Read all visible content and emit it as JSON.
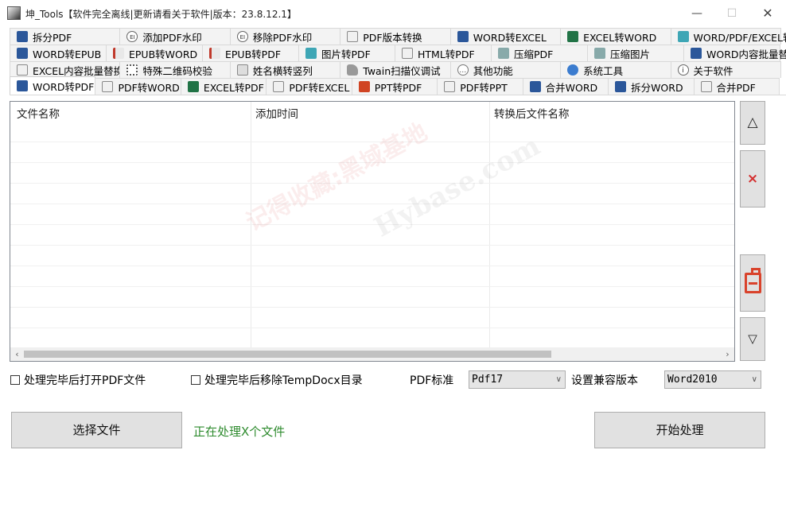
{
  "window": {
    "title": "坤_Tools【软件完全离线|更新请看关于软件|版本：23.8.12.1】",
    "min_icon": "minimize-icon",
    "max_icon": "maximize-icon",
    "close_icon": "close-icon"
  },
  "tab_rows": [
    [
      {
        "label": "拆分PDF",
        "icon": "word"
      },
      {
        "label": "添加PDF水印",
        "icon": "ring"
      },
      {
        "label": "移除PDF水印",
        "icon": "ring"
      },
      {
        "label": "PDF版本转换",
        "icon": "pdf"
      },
      {
        "label": "WORD转EXCEL",
        "icon": "word"
      },
      {
        "label": "EXCEL转WORD",
        "icon": "excel"
      },
      {
        "label": "WORD/PDF/EXCEL转图片",
        "icon": "img"
      }
    ],
    [
      {
        "label": "WORD转EPUB",
        "icon": "word"
      },
      {
        "label": "EPUB转WORD",
        "icon": "epub"
      },
      {
        "label": "EPUB转PDF",
        "icon": "epub"
      },
      {
        "label": "图片转PDF",
        "icon": "img"
      },
      {
        "label": "HTML转PDF",
        "icon": "pdf"
      },
      {
        "label": "压缩PDF",
        "icon": "zip"
      },
      {
        "label": "压缩图片",
        "icon": "zip"
      },
      {
        "label": "WORD内容批量替换",
        "icon": "word"
      }
    ],
    [
      {
        "label": "EXCEL内容批量替换",
        "icon": "pdf"
      },
      {
        "label": "特殊二维码校验",
        "icon": "qr"
      },
      {
        "label": "姓名横转竖列",
        "icon": "name"
      },
      {
        "label": "Twain扫描仪调试",
        "icon": "scan"
      },
      {
        "label": "其他功能",
        "icon": "more"
      },
      {
        "label": "系统工具",
        "icon": "gear"
      },
      {
        "label": "关于软件",
        "icon": "info"
      }
    ],
    [
      {
        "label": "WORD转PDF",
        "icon": "word",
        "active": true
      },
      {
        "label": "PDF转WORD",
        "icon": "pdf"
      },
      {
        "label": "EXCEL转PDF",
        "icon": "excel"
      },
      {
        "label": "PDF转EXCEL",
        "icon": "pdf"
      },
      {
        "label": "PPT转PDF",
        "icon": "ppt"
      },
      {
        "label": "PDF转PPT",
        "icon": "pdf"
      },
      {
        "label": "合并WORD",
        "icon": "word"
      },
      {
        "label": "拆分WORD",
        "icon": "word"
      },
      {
        "label": "合并PDF",
        "icon": "pdf"
      }
    ]
  ],
  "file_list": {
    "columns": [
      "文件名称",
      "添加时间",
      "转换后文件名称"
    ],
    "rows": []
  },
  "side_buttons": {
    "up": "△",
    "delete": "×",
    "clear_icon": "trash-clear-icon",
    "down": "▽"
  },
  "options": {
    "open_pdf_after": "处理完毕后打开PDF文件",
    "remove_temp_after": "处理完毕后移除TempDocx目录",
    "pdf_standard_label": "PDF标准",
    "pdf_standard_value": "Pdf17",
    "compat_label": "设置兼容版本",
    "compat_value": "Word2010"
  },
  "actions": {
    "select_files": "选择文件",
    "status": "正在处理X个文件",
    "start": "开始处理"
  },
  "watermark": {
    "text1": "记得收藏:黑域基地",
    "text2": "Hybase.com"
  }
}
